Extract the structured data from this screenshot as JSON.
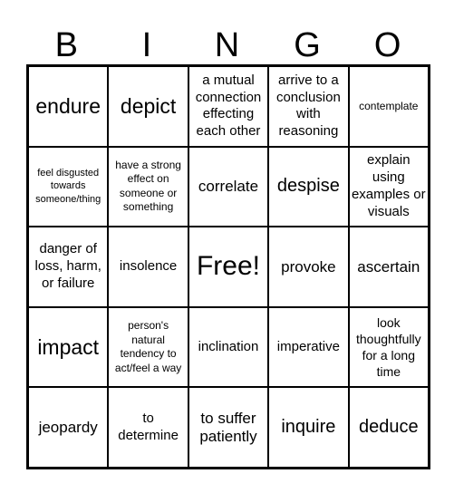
{
  "header": {
    "letters": [
      "B",
      "I",
      "N",
      "G",
      "O"
    ]
  },
  "cells": [
    "endure",
    "depict",
    "a mutual connection effecting each other",
    "arrive to a conclusion with reasoning",
    "contemplate",
    "feel disgusted towards someone/thing",
    "have a strong effect on someone or something",
    "correlate",
    "despise",
    "explain using examples or visuals",
    "danger of loss, harm, or failure",
    "insolence",
    "Free!",
    "provoke",
    "ascertain",
    "impact",
    "person's natural tendency to act/feel a way",
    "inclination",
    "imperative",
    "look thoughtfully for a long time",
    "jeopardy",
    "to determine",
    "to suffer patiently",
    "inquire",
    "deduce"
  ]
}
